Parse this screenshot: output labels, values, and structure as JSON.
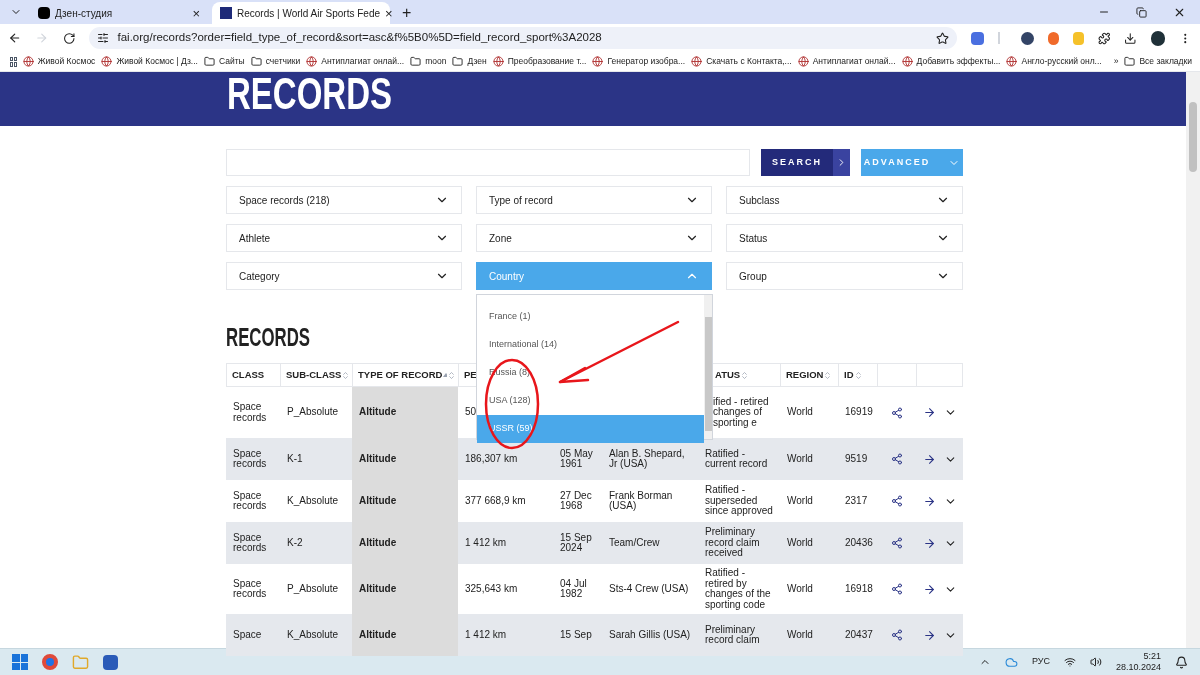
{
  "browser": {
    "tabs": [
      {
        "title": "Дзен-студия",
        "selected": false,
        "close": "×"
      },
      {
        "title": "Records | World Air Sports Fede",
        "selected": true,
        "close": "×"
      }
    ],
    "new_tab": "+",
    "url": "fai.org/records?order=field_type_of_record&sort=asc&f%5B0%5D=field_record_sport%3A2028",
    "bookmarks": [
      {
        "label": "Живой Космос",
        "kind": "site"
      },
      {
        "label": "Живой Космос | Дз...",
        "kind": "site"
      },
      {
        "label": "Сайты",
        "kind": "folder"
      },
      {
        "label": "счетчики",
        "kind": "folder"
      },
      {
        "label": "Антиплагиат онлай...",
        "kind": "site"
      },
      {
        "label": "moon",
        "kind": "folder"
      },
      {
        "label": "Дзен",
        "kind": "folder"
      },
      {
        "label": "Преобразование т...",
        "kind": "site"
      },
      {
        "label": "Генератор изобра...",
        "kind": "site"
      },
      {
        "label": "Скачать с Контакта,...",
        "kind": "site"
      },
      {
        "label": "Антиплагиат онлай...",
        "kind": "site"
      },
      {
        "label": "Добавить эффекты...",
        "kind": "site"
      },
      {
        "label": "Англо-русский онл...",
        "kind": "site"
      }
    ],
    "more": "»",
    "all_bookmarks": "Все закладки"
  },
  "page": {
    "banner_title": "RECORDS",
    "search": {
      "button": "SEARCH",
      "advanced": "ADVANCED"
    },
    "filters": [
      {
        "label": "Space records (218)",
        "open": false
      },
      {
        "label": "Type of record",
        "open": false
      },
      {
        "label": "Subclass",
        "open": false
      },
      {
        "label": "Athlete",
        "open": false
      },
      {
        "label": "Zone",
        "open": false
      },
      {
        "label": "Status",
        "open": false
      },
      {
        "label": "Category",
        "open": false
      },
      {
        "label": "Country",
        "open": true
      },
      {
        "label": "Group",
        "open": false
      }
    ],
    "country_options": [
      {
        "label": "France (1)",
        "selected": false
      },
      {
        "label": "International (14)",
        "selected": false
      },
      {
        "label": "Russia (8)",
        "selected": false
      },
      {
        "label": "USA (128)",
        "selected": false
      },
      {
        "label": "USSR (59)",
        "selected": true
      }
    ],
    "section_title": "RECORDS",
    "columns": [
      {
        "label": "CLASS",
        "sortable": false,
        "sorted": false
      },
      {
        "label": "SUB-CLASS",
        "sortable": true,
        "sorted": false
      },
      {
        "label": "TYPE OF RECORD",
        "sortable": true,
        "sorted": true
      },
      {
        "label": "PE"
      },
      {
        "label": "ATUS",
        "sortable": true,
        "sorted": false
      },
      {
        "label": "REGION",
        "sortable": true,
        "sorted": false
      },
      {
        "label": "ID",
        "sortable": true,
        "sorted": false
      }
    ],
    "rows": [
      {
        "class": "Space records",
        "subclass": "P_Absolute",
        "type": "Altitude",
        "performance": "50",
        "date": "",
        "athlete": "",
        "status": "ified - retired changes of sporting e",
        "region": "World",
        "id": "16919"
      },
      {
        "class": "Space records",
        "subclass": "K-1",
        "type": "Altitude",
        "performance": "186,307 km",
        "date": "05 May 1961",
        "athlete": "Alan B. Shepard, Jr (USA)",
        "status": "Ratified - current record",
        "region": "World",
        "id": "9519"
      },
      {
        "class": "Space records",
        "subclass": "K_Absolute",
        "type": "Altitude",
        "performance": "377 668,9 km",
        "date": "27 Dec 1968",
        "athlete": "Frank Borman (USA)",
        "status": "Ratified - superseded since approved",
        "region": "World",
        "id": "2317"
      },
      {
        "class": "Space records",
        "subclass": "K-2",
        "type": "Altitude",
        "performance": "1 412 km",
        "date": "15 Sep 2024",
        "athlete": "Team/Crew",
        "status": "Preliminary record claim received",
        "region": "World",
        "id": "20436"
      },
      {
        "class": "Space records",
        "subclass": "P_Absolute",
        "type": "Altitude",
        "performance": "325,643 km",
        "date": "04 Jul 1982",
        "athlete": "Sts-4 Crew (USA)",
        "status": "Ratified - retired by changes of the sporting code",
        "region": "World",
        "id": "16918"
      },
      {
        "class": "Space",
        "subclass": "K_Absolute",
        "type": "Altitude",
        "performance": "1 412 km",
        "date": "15 Sep",
        "athlete": "Sarah Gillis (USA)",
        "status": "Preliminary record claim",
        "region": "World",
        "id": "20437"
      }
    ]
  },
  "taskbar": {
    "language": "РУС",
    "time": "5:21",
    "date": "28.10.2024"
  }
}
